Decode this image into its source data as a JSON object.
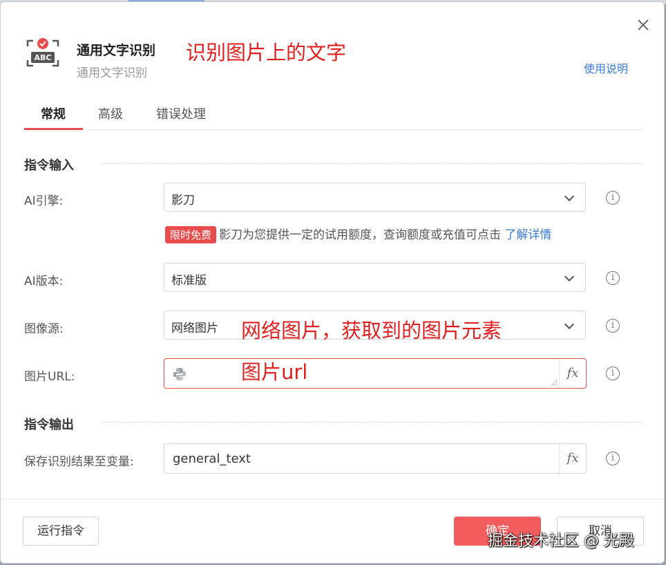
{
  "header": {
    "title": "通用文字识别",
    "subtitle": "通用文字识别",
    "icon": "ocr-abc-icon",
    "help_link": "使用说明"
  },
  "annotations": {
    "title_note": "识别图片上的文字",
    "source_note": "网络图片，获取到的图片元素",
    "url_note": "图片url"
  },
  "tabs": [
    {
      "label": "常规",
      "active": true
    },
    {
      "label": "高级",
      "active": false
    },
    {
      "label": "错误处理",
      "active": false
    }
  ],
  "sections": {
    "input": "指令输入",
    "output": "指令输出"
  },
  "fields": {
    "ai_engine": {
      "label": "AI引擎:",
      "value": "影刀"
    },
    "engine_note": {
      "badge": "限时免费",
      "text": "影刀为您提供一定的试用额度，查询额度或充值可点击",
      "link": "了解详情"
    },
    "ai_version": {
      "label": "AI版本:",
      "value": "标准版"
    },
    "image_source": {
      "label": "图像源:",
      "value": "网络图片"
    },
    "image_url": {
      "label": "图片URL:",
      "value": "",
      "fx": "fx"
    },
    "save_var": {
      "label": "保存识别结果至变量:",
      "value": "general_text",
      "fx": "fx"
    }
  },
  "footer": {
    "run": "运行指令",
    "ok": "确定",
    "cancel": "取消"
  },
  "watermark": "掘金技术社区 @ 光殿",
  "colors": {
    "accent": "#e94c4c",
    "link": "#3a7bd5",
    "annotation": "#e02020"
  }
}
